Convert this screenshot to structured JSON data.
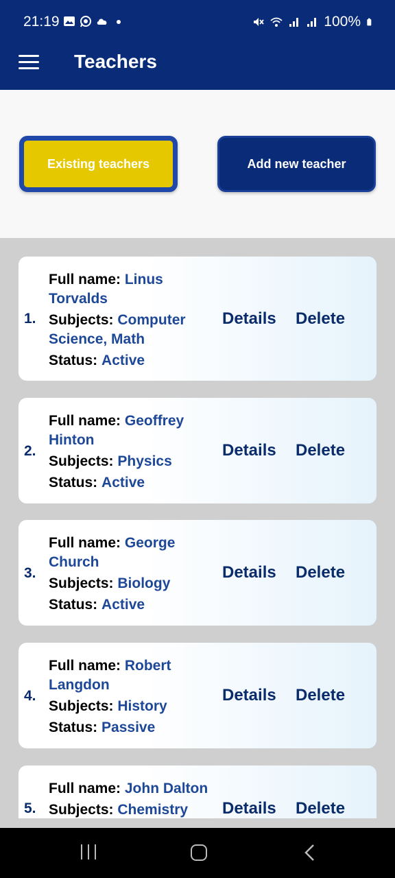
{
  "status_bar": {
    "time": "21:19",
    "battery": "100%",
    "left_icons": [
      "gallery-icon",
      "whatsapp-icon",
      "cloud-icon",
      "dot-icon"
    ],
    "right_icons": [
      "mute-icon",
      "wifi-icon",
      "signal-icon",
      "signal-icon",
      "battery-icon"
    ]
  },
  "app_bar": {
    "title": "Teachers",
    "menu_icon": "hamburger-icon"
  },
  "tabs": {
    "existing_label": "Existing teachers",
    "add_label": "Add new teacher"
  },
  "labels": {
    "full_name": "Full name:",
    "subjects": "Subjects:",
    "status": "Status:",
    "details": "Details",
    "delete": "Delete"
  },
  "teachers": [
    {
      "index": "1.",
      "name": "Linus Torvalds",
      "subjects": "Computer Science, Math",
      "status": "Active"
    },
    {
      "index": "2.",
      "name": "Geoffrey Hinton",
      "subjects": "Physics",
      "status": "Active"
    },
    {
      "index": "3.",
      "name": "George Church",
      "subjects": "Biology",
      "status": "Active"
    },
    {
      "index": "4.",
      "name": "Robert Langdon",
      "subjects": "History",
      "status": "Passive"
    },
    {
      "index": "5.",
      "name": "John Dalton",
      "subjects": "Chemistry",
      "status": ""
    }
  ],
  "colors": {
    "primary": "#0a2c78",
    "accent_yellow": "#e6c800",
    "value_blue": "#1d4797",
    "background": "#cfcfcf"
  }
}
